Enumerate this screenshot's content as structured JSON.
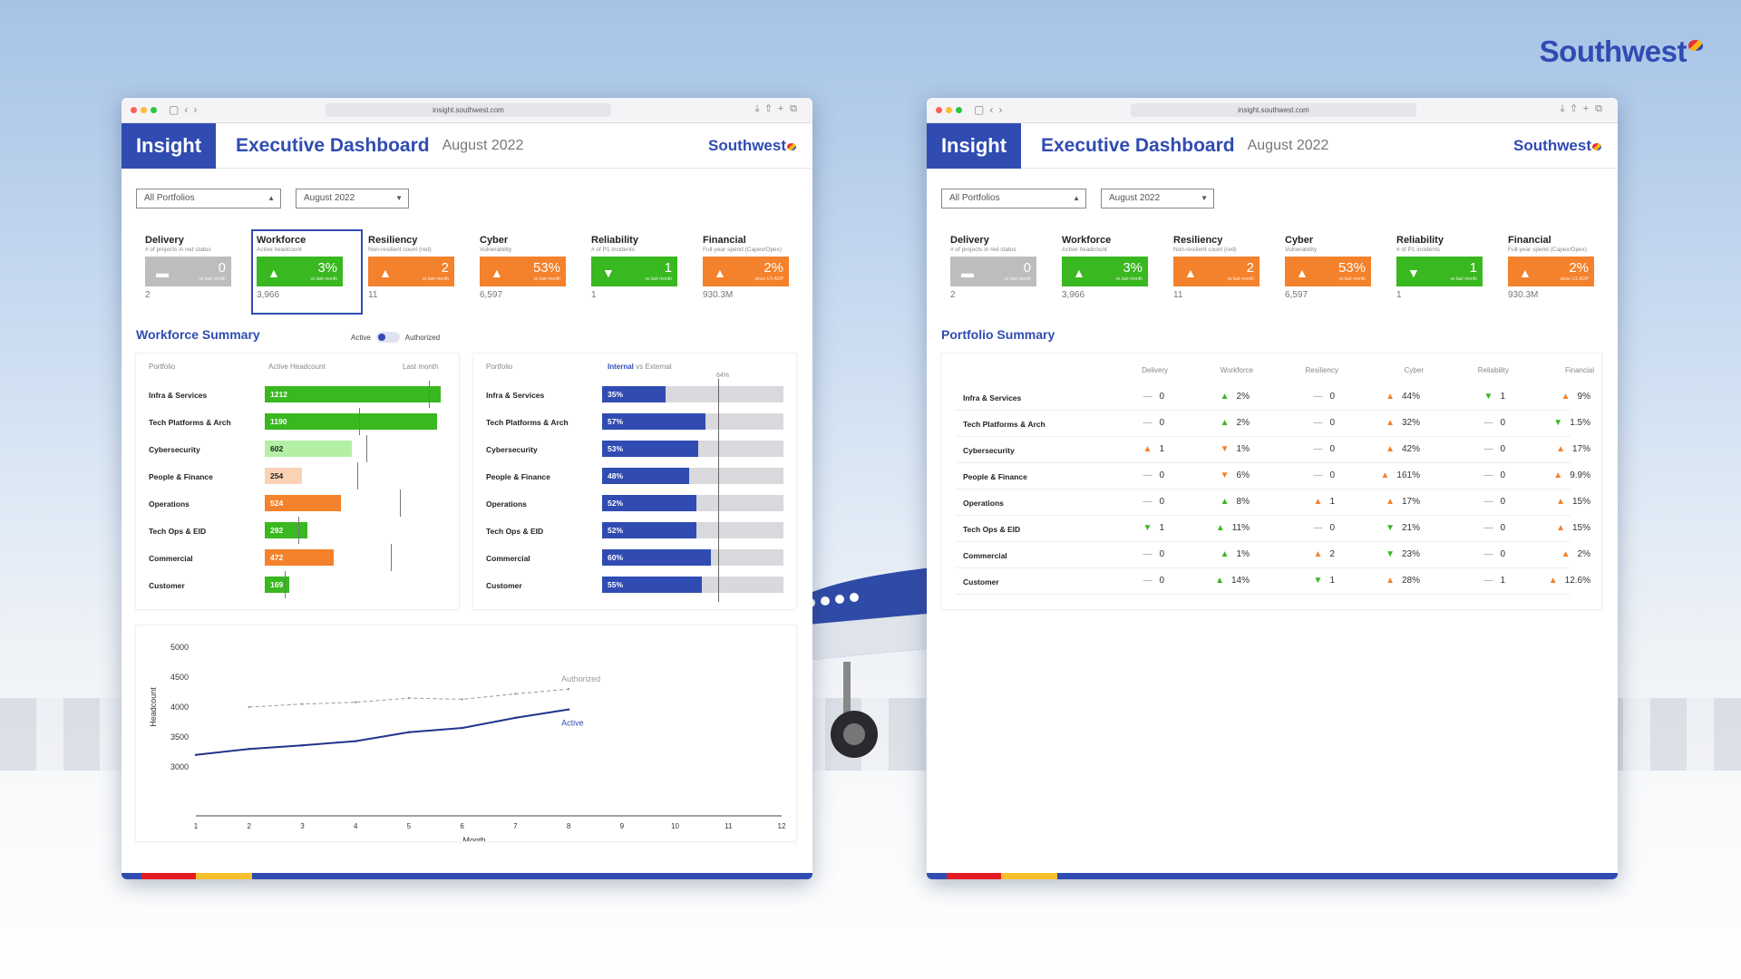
{
  "brand": "Southwest",
  "url": "insight.southwest.com",
  "app": {
    "logo": "Insight",
    "title": "Executive Dashboard",
    "month": "August 2022",
    "brand": "Southwest"
  },
  "filters": {
    "portfolio": "All Portfolios",
    "period": "August 2022"
  },
  "colors": {
    "blue": "#304cb2",
    "green": "#39b81f",
    "orange": "#f4812b",
    "lightgreen": "#b3efa4",
    "peach": "#fbd2b6",
    "gray": "#bdbdbf",
    "red": "#e31c23",
    "yellow": "#f9c02e"
  },
  "kpis": [
    {
      "title": "Delivery",
      "sub": "# of projects in red status",
      "value": "0",
      "note": "vs last month",
      "trend": "flat",
      "color": "gray",
      "bottom": "2"
    },
    {
      "title": "Workforce",
      "sub": "Active headcount",
      "value": "3%",
      "note": "vs last month",
      "trend": "up",
      "color": "green",
      "bottom": "3,966"
    },
    {
      "title": "Resiliency",
      "sub": "Non-resilient count (red)",
      "value": "2",
      "note": "vs last month",
      "trend": "up",
      "color": "orange",
      "bottom": "11"
    },
    {
      "title": "Cyber",
      "sub": "Vulnerability",
      "value": "53%",
      "note": "vs last month",
      "trend": "up",
      "color": "orange",
      "bottom": "6,597"
    },
    {
      "title": "Reliability",
      "sub": "# of P1 incidents",
      "value": "1",
      "note": "vs last month",
      "trend": "down",
      "color": "green",
      "bottom": "1"
    },
    {
      "title": "Financial",
      "sub": "Full-year spend",
      "sub2": "(Capex/Opex)",
      "value": "2%",
      "note": "since 1/1 AOP",
      "trend": "up",
      "color": "orange",
      "bottom": "930.3M"
    }
  ],
  "workforce": {
    "title": "Workforce Summary",
    "toggle_active": "Active",
    "toggle_authorized": "Authorized",
    "col_portfolio": "Portfolio",
    "col_headcount": "Active Headcount",
    "col_last": "Last month",
    "col_internal": "Internal",
    "col_vs": " vs External",
    "ref_label": "64%",
    "rows": [
      {
        "name": "Infra & Services",
        "headcount": "1212",
        "hc": 1212,
        "last": 1130,
        "color": "green",
        "internal": "35%",
        "int": 35
      },
      {
        "name": "Tech Platforms & Arch",
        "headcount": "1190",
        "hc": 1190,
        "last": 650,
        "color": "green",
        "internal": "57%",
        "int": 57
      },
      {
        "name": "Cybersecurity",
        "headcount": "602",
        "hc": 602,
        "last": 700,
        "color": "lightgreen",
        "internal": "53%",
        "int": 53
      },
      {
        "name": "People & Finance",
        "headcount": "254",
        "hc": 254,
        "last": 640,
        "color": "peach",
        "internal": "48%",
        "int": 48
      },
      {
        "name": "Operations",
        "headcount": "524",
        "hc": 524,
        "last": 930,
        "color": "orange",
        "internal": "52%",
        "int": 52
      },
      {
        "name": "Tech Ops & EID",
        "headcount": "292",
        "hc": 292,
        "last": 230,
        "color": "green",
        "internal": "52%",
        "int": 52
      },
      {
        "name": "Commercial",
        "headcount": "472",
        "hc": 472,
        "last": 870,
        "color": "orange",
        "internal": "60%",
        "int": 60
      },
      {
        "name": "Customer",
        "headcount": "169",
        "hc": 169,
        "last": 140,
        "color": "green",
        "internal": "55%",
        "int": 55
      }
    ]
  },
  "chart_data": {
    "type": "line",
    "xlabel": "Month",
    "ylabel": "Headcount",
    "x": [
      1,
      2,
      3,
      4,
      5,
      6,
      7,
      8,
      9,
      10,
      11,
      12
    ],
    "ylim": [
      3000,
      5000
    ],
    "yticks": [
      "5000",
      "4500",
      "4000",
      "3500",
      "3000"
    ],
    "xticks": [
      "1",
      "2",
      "3",
      "4",
      "5",
      "6",
      "7",
      "8",
      "9",
      "10",
      "11",
      "12"
    ],
    "series": [
      {
        "name": "Authorized",
        "x": [
          2,
          3,
          4,
          5,
          6,
          7,
          8
        ],
        "values": [
          4000,
          4050,
          4080,
          4150,
          4130,
          4220,
          4300
        ],
        "style": "dashed"
      },
      {
        "name": "Active",
        "x": [
          1,
          2,
          3,
          4,
          5,
          6,
          7,
          8
        ],
        "values": [
          3200,
          3300,
          3360,
          3430,
          3580,
          3650,
          3820,
          3960
        ],
        "style": "solid"
      }
    ]
  },
  "portfolio": {
    "title": "Portfolio Summary",
    "headers": [
      "Delivery",
      "Workforce",
      "Resiliency",
      "Cyber",
      "Reliability",
      "Financial"
    ],
    "rows": [
      {
        "name": "Infra & Services",
        "cells": [
          [
            "flat",
            "0"
          ],
          [
            "up-g",
            "2%"
          ],
          [
            "flat",
            "0"
          ],
          [
            "up-o",
            "44%"
          ],
          [
            "down-g",
            "1"
          ],
          [
            "up-o",
            "9%"
          ]
        ]
      },
      {
        "name": "Tech Platforms & Arch",
        "cells": [
          [
            "flat",
            "0"
          ],
          [
            "up-g",
            "2%"
          ],
          [
            "flat",
            "0"
          ],
          [
            "up-o",
            "32%"
          ],
          [
            "flat",
            "0"
          ],
          [
            "down-g",
            "1.5%"
          ]
        ]
      },
      {
        "name": "Cybersecurity",
        "cells": [
          [
            "up-o",
            "1"
          ],
          [
            "down-o",
            "1%"
          ],
          [
            "flat",
            "0"
          ],
          [
            "up-o",
            "42%"
          ],
          [
            "flat",
            "0"
          ],
          [
            "up-o",
            "17%"
          ]
        ]
      },
      {
        "name": "People & Finance",
        "cells": [
          [
            "flat",
            "0"
          ],
          [
            "down-o",
            "6%"
          ],
          [
            "flat",
            "0"
          ],
          [
            "up-o",
            "161%"
          ],
          [
            "flat",
            "0"
          ],
          [
            "up-o",
            "9.9%"
          ]
        ]
      },
      {
        "name": "Operations",
        "cells": [
          [
            "flat",
            "0"
          ],
          [
            "up-g",
            "8%"
          ],
          [
            "up-o",
            "1"
          ],
          [
            "up-o",
            "17%"
          ],
          [
            "flat",
            "0"
          ],
          [
            "up-o",
            "15%"
          ]
        ]
      },
      {
        "name": "Tech Ops & EID",
        "cells": [
          [
            "down-g",
            "1"
          ],
          [
            "up-g",
            "11%"
          ],
          [
            "flat",
            "0"
          ],
          [
            "down-g",
            "21%"
          ],
          [
            "flat",
            "0"
          ],
          [
            "up-o",
            "15%"
          ]
        ]
      },
      {
        "name": "Commercial",
        "cells": [
          [
            "flat",
            "0"
          ],
          [
            "up-g",
            "1%"
          ],
          [
            "up-o",
            "2"
          ],
          [
            "down-g",
            "23%"
          ],
          [
            "flat",
            "0"
          ],
          [
            "up-o",
            "2%"
          ]
        ]
      },
      {
        "name": "Customer",
        "cells": [
          [
            "flat",
            "0"
          ],
          [
            "up-g",
            "14%"
          ],
          [
            "down-g",
            "1"
          ],
          [
            "up-o",
            "28%"
          ],
          [
            "flat",
            "1"
          ],
          [
            "up-o",
            "12.6%"
          ]
        ]
      }
    ]
  }
}
